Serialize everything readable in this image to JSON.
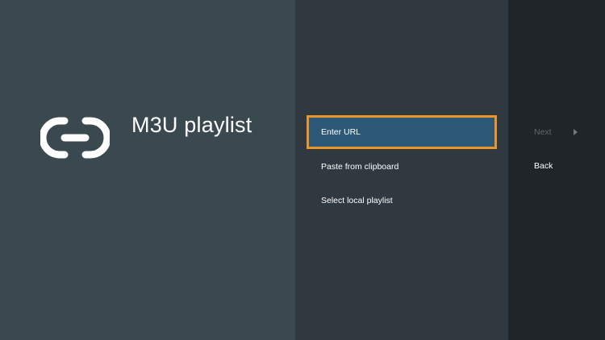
{
  "header": {
    "title": "M3U playlist",
    "icon": "link-icon"
  },
  "actions": [
    {
      "label": "Enter URL",
      "focused": true
    },
    {
      "label": "Paste from clipboard",
      "focused": false
    },
    {
      "label": "Select local playlist",
      "focused": false
    }
  ],
  "nav": {
    "next_label": "Next",
    "next_enabled": false,
    "back_label": "Back"
  },
  "colors": {
    "focus_border": "#e9952a",
    "focus_fill": "#2e5878"
  }
}
